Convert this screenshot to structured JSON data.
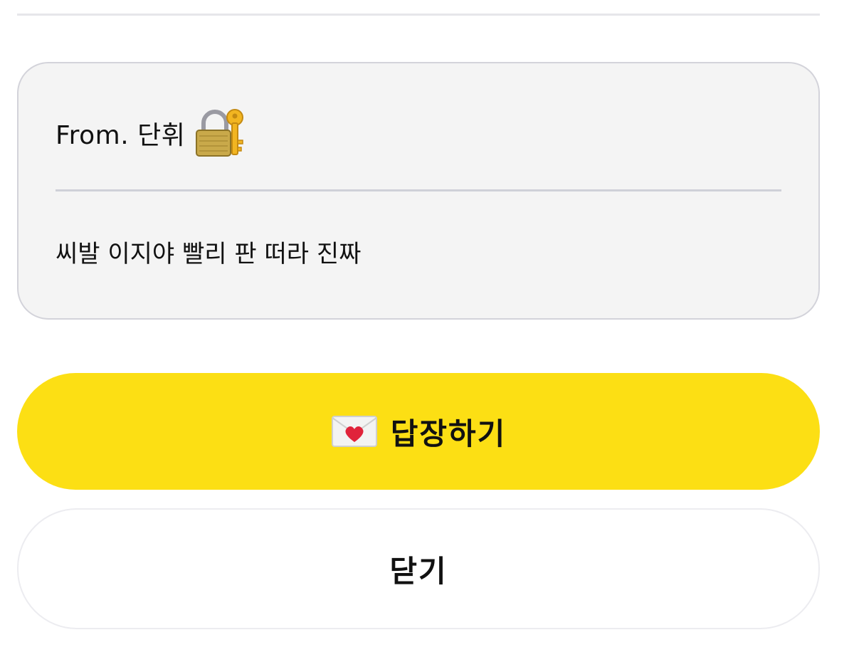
{
  "card": {
    "sender": "From. 단휘",
    "sender_icon": "lock-with-key-icon",
    "message": "씨발 이지야 빨리 판 떠라 진짜"
  },
  "actions": {
    "reply_icon": "love-letter-icon",
    "reply_label": "답장하기",
    "close_label": "닫기"
  },
  "colors": {
    "accent": "#fcdf14",
    "card_background": "#f4f4f4",
    "card_border": "#d3d3da"
  }
}
